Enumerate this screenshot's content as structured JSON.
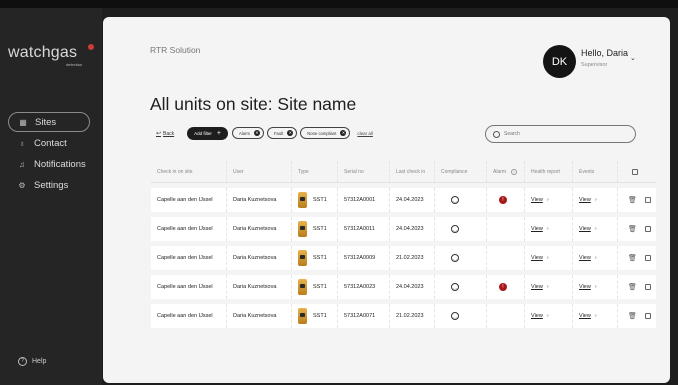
{
  "brand": {
    "logo_text": "watchgas",
    "logo_sub": "detection"
  },
  "sidebar": {
    "items": [
      {
        "label": "Sites",
        "icon": "grid-icon"
      },
      {
        "label": "Contact",
        "icon": "person-icon"
      },
      {
        "label": "Notifications",
        "icon": "bell-icon"
      },
      {
        "label": "Settings",
        "icon": "gear-icon"
      }
    ],
    "help_label": "Help"
  },
  "header": {
    "app_name": "RTR Solution",
    "user_initials": "DK",
    "greeting": "Hello, Daria",
    "role": "Supervisor"
  },
  "page": {
    "title": "All units on site: Site name"
  },
  "filters": {
    "back_label": "Back",
    "add_filter_label": "Add filter",
    "chips": [
      "Alarm",
      "Fault",
      "None compliant"
    ],
    "clear_all_label": "clear all"
  },
  "search": {
    "placeholder": "Search"
  },
  "table": {
    "headers": [
      "Check in on site",
      "User",
      "Type",
      "Serial no",
      "Last check in",
      "Compliance",
      "Alarm",
      "Health report",
      "Events"
    ],
    "rows": [
      {
        "site": "Capelle aan den IJssel",
        "user": "Daria Kuznetsova",
        "type": "SST1",
        "serial": "57312A0001",
        "last_check": "24.04.2023",
        "alarm": true,
        "health": "View",
        "events": "View"
      },
      {
        "site": "Capelle aan den IJssel",
        "user": "Daria Kuznetsova",
        "type": "SST1",
        "serial": "57312A0011",
        "last_check": "24.04.2023",
        "alarm": false,
        "health": "View",
        "events": "View"
      },
      {
        "site": "Capelle aan den IJssel",
        "user": "Daria Kuznetsova",
        "type": "SST1",
        "serial": "57312A0009",
        "last_check": "21.02.2023",
        "alarm": false,
        "health": "View",
        "events": "View"
      },
      {
        "site": "Capelle aan den IJssel",
        "user": "Daria Kuznetsova",
        "type": "SST1",
        "serial": "57312A0023",
        "last_check": "24.04.2023",
        "alarm": true,
        "health": "View",
        "events": "View"
      },
      {
        "site": "Capelle aan den IJssel",
        "user": "Daria Kuznetsova",
        "type": "SST1",
        "serial": "57312A0071",
        "last_check": "21.02.2023",
        "alarm": false,
        "health": "View",
        "events": "View"
      }
    ]
  },
  "colors": {
    "alarm": "#a81818",
    "sidebar_bg": "#252525",
    "content_bg": "#f4f4f4",
    "logo_accent": "#d23a3a"
  }
}
